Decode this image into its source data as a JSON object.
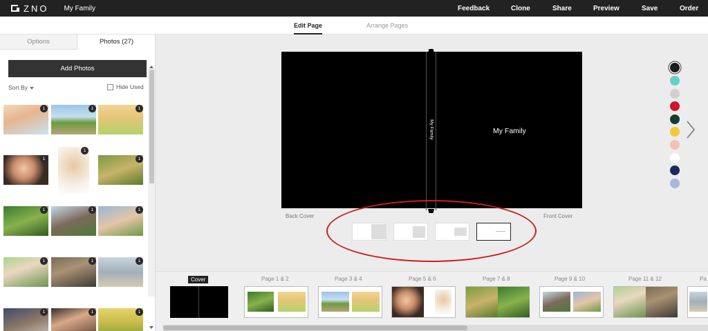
{
  "app": {
    "logo_text": "ZNO",
    "project_title": "My Family"
  },
  "topnav": {
    "feedback": "Feedback",
    "clone": "Clone",
    "share": "Share",
    "preview": "Preview",
    "save": "Save",
    "order": "Order"
  },
  "modes": {
    "edit": "Edit Page",
    "arrange": "Arrange Pages",
    "active": "Edit Page"
  },
  "panel": {
    "tab_options": "Options",
    "tab_photos": "Photos (27)",
    "add_photos": "Add Photos",
    "sort_by": "Sort By",
    "hide_used": "Hide Used",
    "hide_used_checked": false,
    "photo_badge": "1"
  },
  "canvas": {
    "spine_text": "My Family",
    "cover_title": "My Family",
    "back_label": "Back Cover",
    "front_label": "Front Cover",
    "background_color": "#000000",
    "layout_options_selected": 4,
    "highlight_color": "#cc1d1d"
  },
  "colors": {
    "swatches": [
      "#1c1c1c",
      "#62d0c6",
      "#d0d0d0",
      "#d0142a",
      "#183b32",
      "#f5c63a",
      "#f2c2b4",
      "#ffffff",
      "#1b2a5a",
      "#a8b7df"
    ],
    "selected_index": 0
  },
  "filmstrip": {
    "cover_label": "Cover",
    "pages": [
      "Page 1 & 2",
      "Page 3 & 4",
      "Page 5 & 6",
      "Page 7 & 8",
      "Page 9 & 10",
      "Page 11 & 12"
    ],
    "partial_label": "Pa"
  },
  "icons": {
    "next": "chevron-right-icon",
    "sort": "caret-down-icon"
  }
}
